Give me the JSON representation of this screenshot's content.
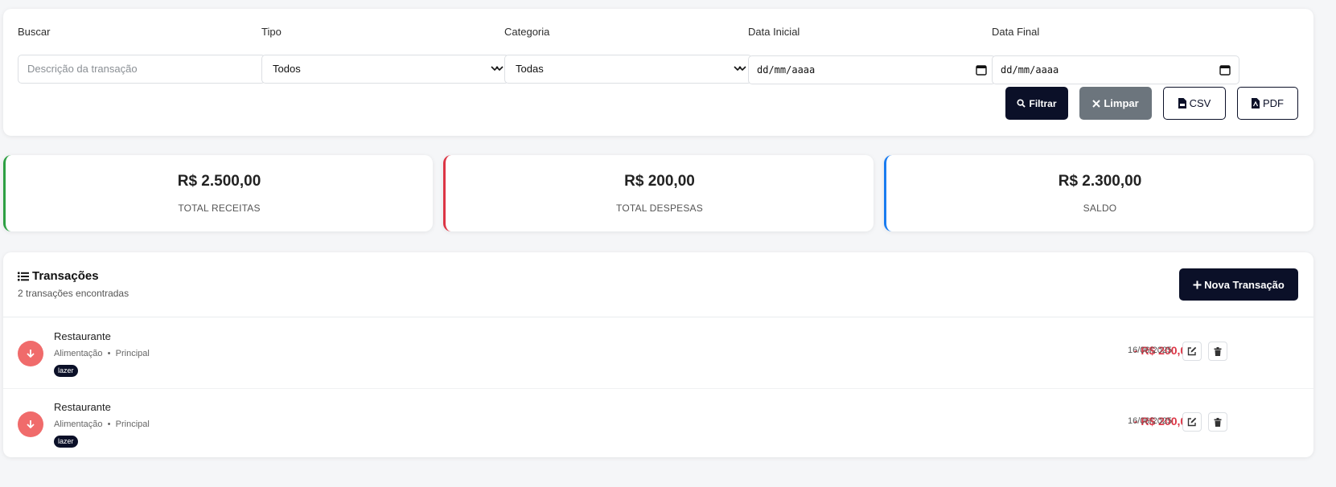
{
  "filters": {
    "search": {
      "label": "Buscar",
      "placeholder": "Descrição da transação"
    },
    "type": {
      "label": "Tipo",
      "value": "Todos"
    },
    "category": {
      "label": "Categoria",
      "value": "Todas"
    },
    "start_date": {
      "label": "Data Inicial",
      "value": "dd/mm/aaaa"
    },
    "end_date": {
      "label": "Data Final",
      "value": "dd/mm/aaaa"
    },
    "buttons": {
      "filter": "Filtrar",
      "clear": "Limpar",
      "csv": "CSV",
      "pdf": "PDF"
    }
  },
  "summary": {
    "income": {
      "amount": "R$ 2.500,00",
      "label": "TOTAL RECEITAS",
      "color": "#2ea043"
    },
    "expenses": {
      "amount": "R$ 200,00",
      "label": "TOTAL DESPESAS",
      "color": "#dc3545"
    },
    "balance": {
      "amount": "R$ 2.300,00",
      "label": "SALDO",
      "color": "#1a7cf0"
    }
  },
  "transactions": {
    "title": "Transações",
    "count_text": "2 transações encontradas",
    "new_button": "Nova Transação",
    "items": [
      {
        "name": "Restaurante",
        "category": "Alimentação",
        "account": "Principal",
        "tag": "lazer",
        "amount": "- R$ 200,00",
        "date": "16/06/2025",
        "icon": "arrow-down-icon"
      },
      {
        "name": "Restaurante",
        "category": "Alimentação",
        "account": "Principal",
        "tag": "lazer",
        "amount": "- R$ 200,00",
        "date": "16/06/2025",
        "icon": "arrow-down-icon"
      }
    ]
  },
  "colors": {
    "primary": "#0b1028",
    "secondary": "#6c757d",
    "expense": "#dc3545",
    "expense_icon_bg": "#f06b6b"
  }
}
